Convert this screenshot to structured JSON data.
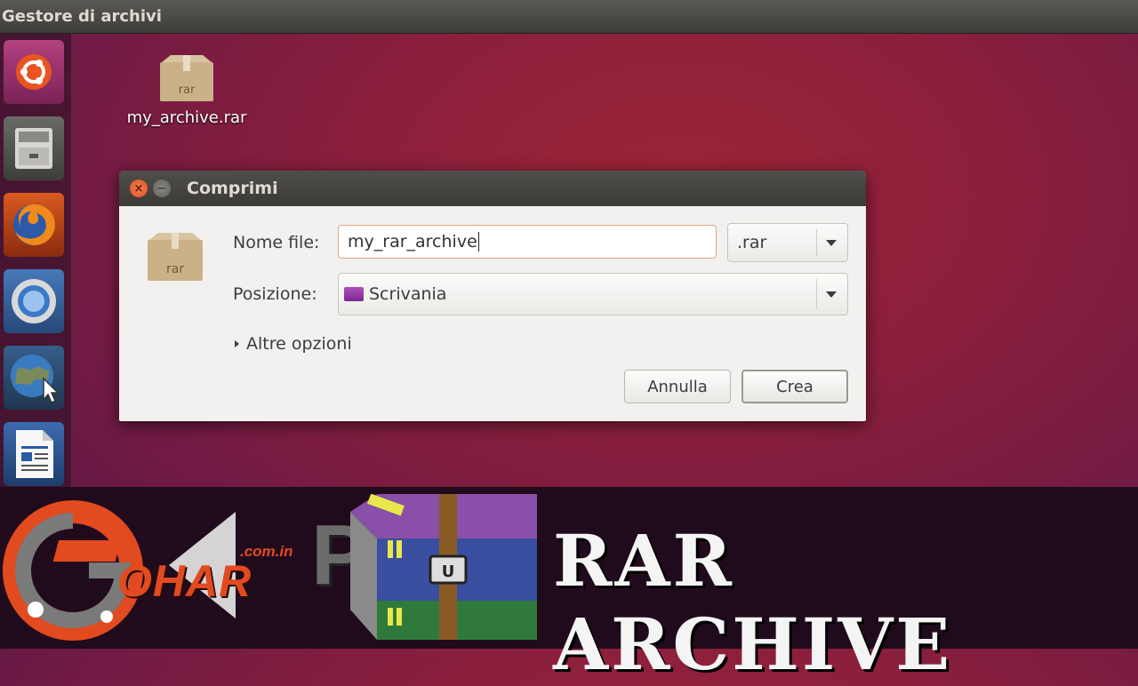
{
  "top_panel": {
    "title": "Gestore di archivi"
  },
  "launcher": {
    "items": [
      "ubuntu-dash",
      "files",
      "firefox",
      "chromium",
      "web-browser",
      "libreoffice-writer"
    ]
  },
  "desktop": {
    "icon_label": "my_archive.rar",
    "icon_badge": "rar"
  },
  "dialog": {
    "title": "Comprimi",
    "icon_badge": "rar",
    "filename_label": "Nome file:",
    "filename_value": "my_rar_archive",
    "extension_value": ".rar",
    "location_label": "Posizione:",
    "location_value": "Scrivania",
    "more_options": "Altre opzioni",
    "cancel_label": "Annulla",
    "create_label": "Crea"
  },
  "banner": {
    "title": "RAR ARCHIVE",
    "logo_domain": ".com.in",
    "logo_name": "OHAR",
    "logo_pc": "PC"
  },
  "colors": {
    "desktop_bg": "#8a1f3c",
    "panel": "#3d3c38",
    "accent_orange": "#e24a1f",
    "banner_bg": "#200b1c"
  }
}
